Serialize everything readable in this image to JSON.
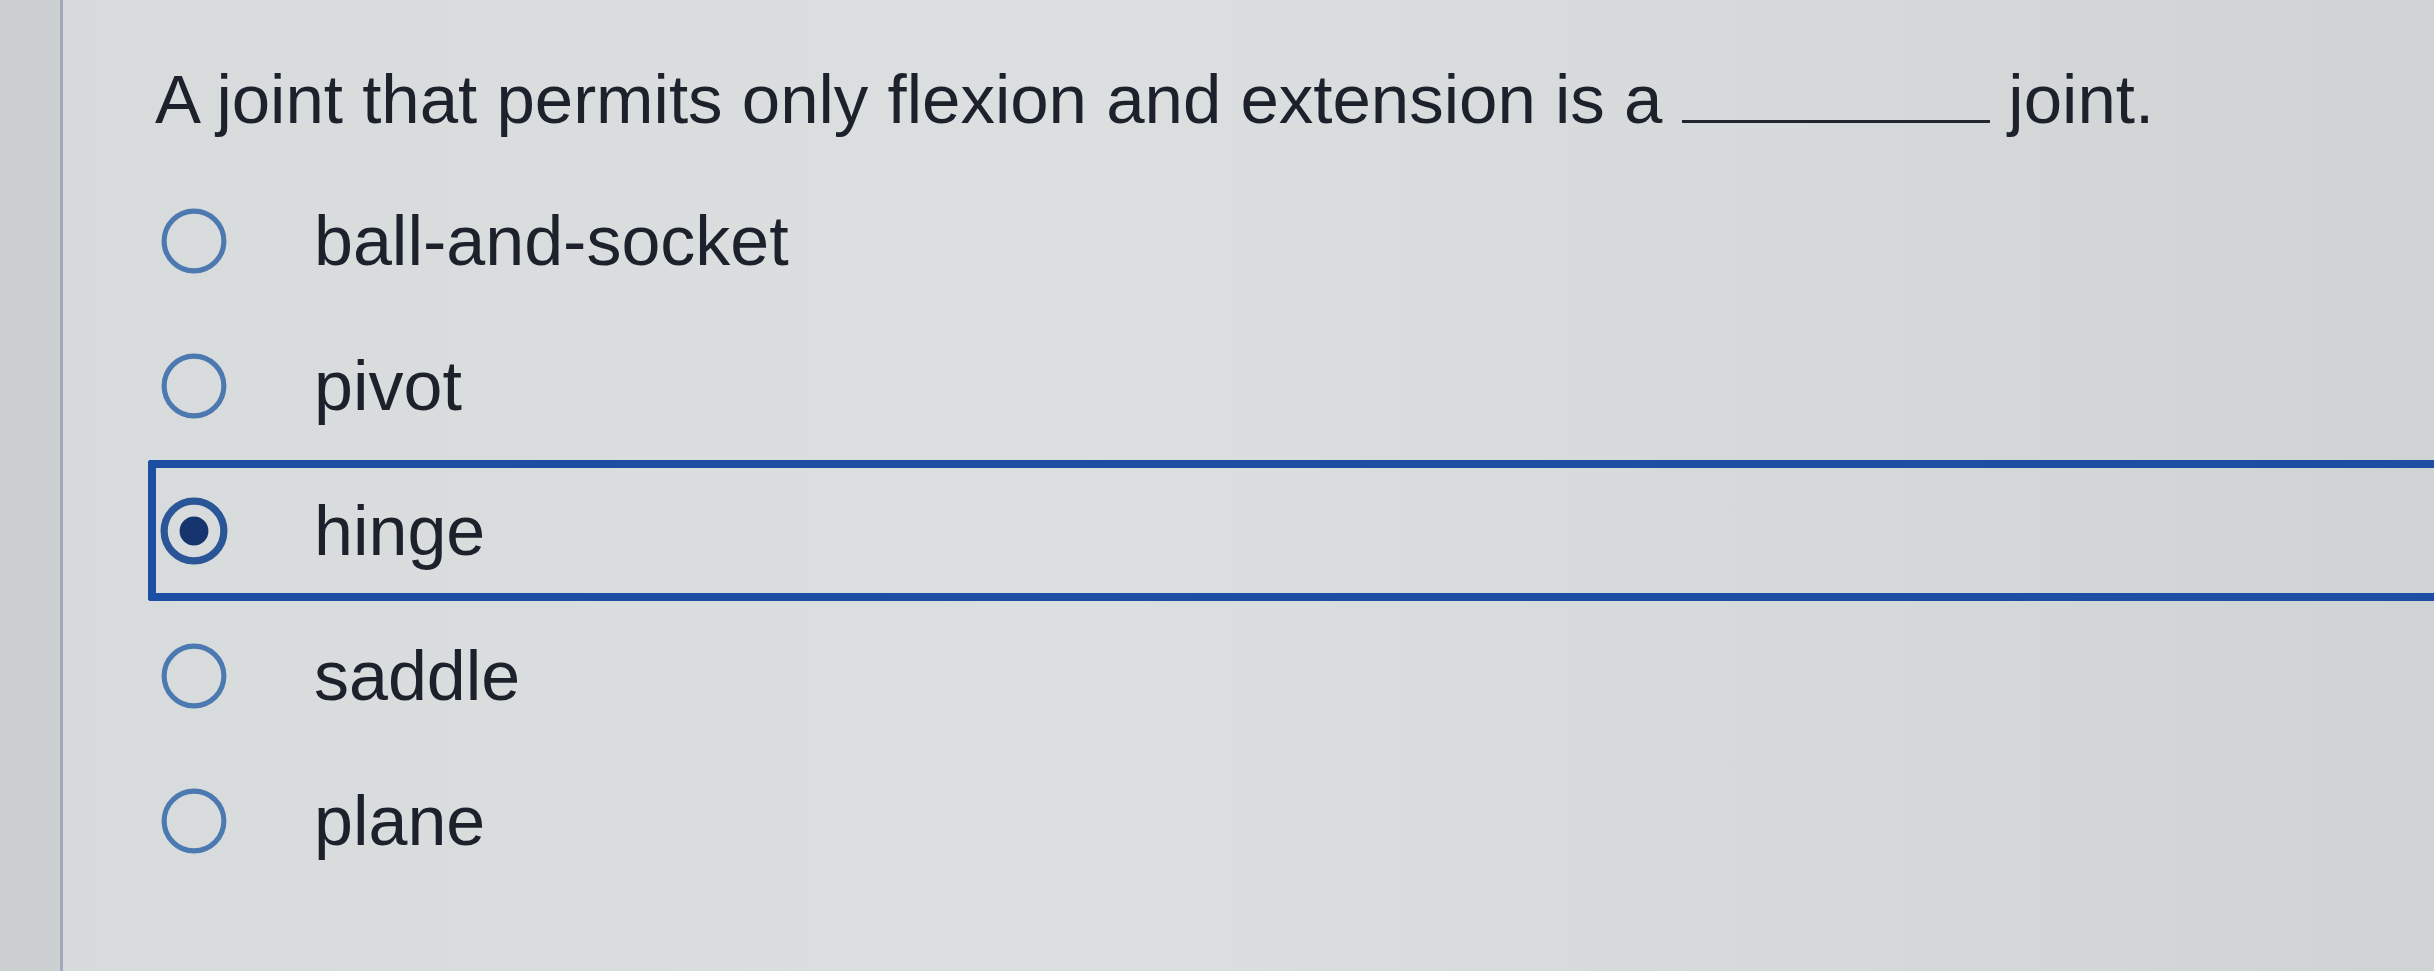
{
  "question": {
    "text_before": "A joint that permits only flexion and extension is a",
    "text_after": "joint."
  },
  "options": [
    {
      "label": "ball-and-socket",
      "selected": false
    },
    {
      "label": "pivot",
      "selected": false
    },
    {
      "label": "hinge",
      "selected": true
    },
    {
      "label": "saddle",
      "selected": false
    },
    {
      "label": "plane",
      "selected": false
    }
  ]
}
